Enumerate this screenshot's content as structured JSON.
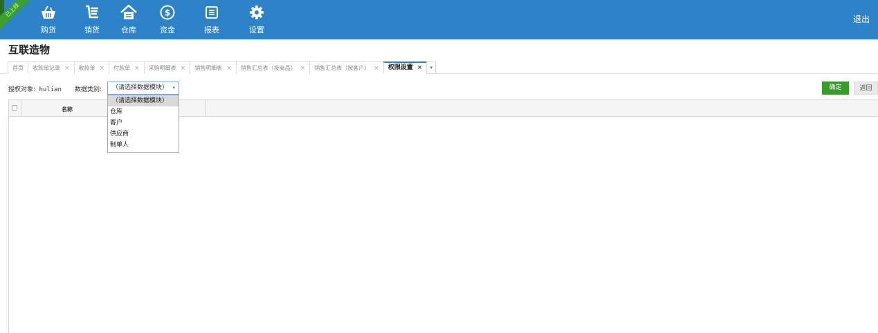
{
  "ribbon": {
    "text": "已上线"
  },
  "nav": {
    "items": [
      {
        "label": "购货",
        "icon": "basket-icon"
      },
      {
        "label": "销货",
        "icon": "cart-icon"
      },
      {
        "label": "仓库",
        "icon": "warehouse-icon"
      },
      {
        "label": "资金",
        "icon": "dollar-icon"
      },
      {
        "label": "报表",
        "icon": "report-icon"
      },
      {
        "label": "设置",
        "icon": "gear-icon"
      }
    ],
    "logout": "退出"
  },
  "company": "互联造物",
  "tabs": [
    {
      "label": "首页"
    },
    {
      "label": "收款单记录"
    },
    {
      "label": "收款单"
    },
    {
      "label": "付款单"
    },
    {
      "label": "采购明细表"
    },
    {
      "label": "销售明细表"
    },
    {
      "label": "销售汇总表（按商品）"
    },
    {
      "label": "销售汇总表（按客户）"
    },
    {
      "label": "权限设置"
    }
  ],
  "tab_close": "×",
  "tab_more": "▾",
  "toolbar": {
    "target_label": "授权对象:",
    "target_value": "hulian",
    "type_label": "数据类别:",
    "select_value": "（请选择数据模块）",
    "caret": "▾",
    "ok": "确定",
    "back": "返回"
  },
  "grid": {
    "name_header": "名称"
  },
  "dropdown": {
    "options": [
      "（请选择数据模块）",
      "仓库",
      "客户",
      "供应商",
      "制单人"
    ],
    "selected": 0
  },
  "colors": {
    "topbar": "#2e82c8",
    "ok_button": "#3a9a2c",
    "active_tab": "#2e82c8"
  }
}
